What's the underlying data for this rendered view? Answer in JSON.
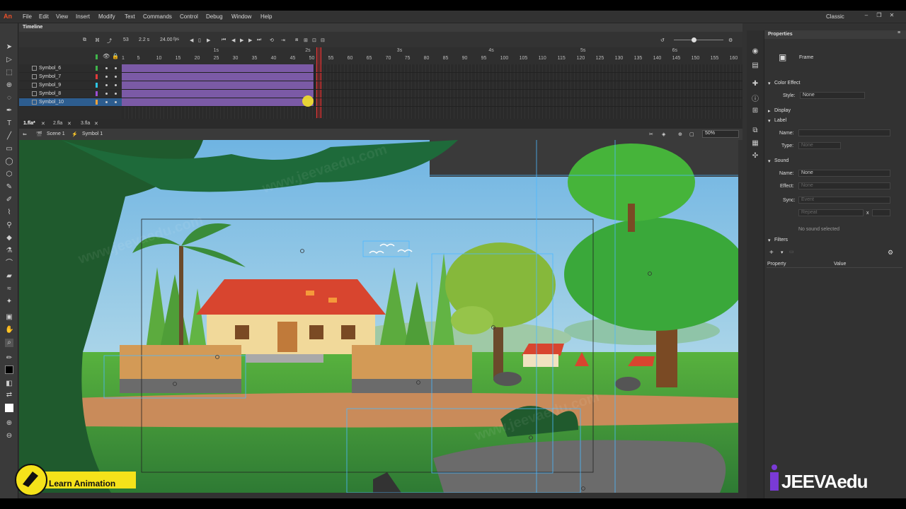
{
  "app": {
    "logo": "An",
    "menu": [
      "File",
      "Edit",
      "View",
      "Insert",
      "Modify",
      "Text",
      "Commands",
      "Control",
      "Debug",
      "Window",
      "Help"
    ],
    "workspace": "Classic"
  },
  "timeline": {
    "title": "Timeline",
    "current_frame": "53",
    "elapsed": "2.2 s",
    "fps": "24.00",
    "fps_unit": "fps",
    "seconds_marks": [
      "1s",
      "2s",
      "3s",
      "4s",
      "5s",
      "6s"
    ],
    "frame_numbers": [
      "1",
      "5",
      "10",
      "15",
      "20",
      "25",
      "30",
      "35",
      "40",
      "45",
      "50",
      "55",
      "60",
      "65",
      "70",
      "75",
      "80",
      "85",
      "90",
      "95",
      "100",
      "105",
      "110",
      "115",
      "120",
      "125",
      "130",
      "135",
      "140",
      "145",
      "150",
      "155",
      "160"
    ],
    "layers": [
      {
        "name": "Symbol_6",
        "color": "#3fb54b"
      },
      {
        "name": "Symbol_7",
        "color": "#e23b3b"
      },
      {
        "name": "Symbol_9",
        "color": "#2ec7e6"
      },
      {
        "name": "Symbol_8",
        "color": "#9c4fd6"
      },
      {
        "name": "Symbol_10",
        "color": "#f2a23a"
      }
    ],
    "tween_color": "#7b5aa6"
  },
  "doc_tabs": [
    "1.fla*",
    "2.fla",
    "3.fla"
  ],
  "edit_bar": {
    "scene": "Scene 1",
    "symbol": "Symbol 1",
    "zoom": "50%"
  },
  "properties": {
    "title": "Properties",
    "target": "Frame",
    "color_effect": {
      "section": "Color Effect",
      "style_label": "Style:",
      "style_value": "None"
    },
    "display": "Display",
    "label": {
      "section": "Label",
      "name_label": "Name:",
      "type_label": "Type:",
      "type_value": "None"
    },
    "sound": {
      "section": "Sound",
      "name_label": "Name:",
      "name_value": "None",
      "effect_label": "Effect:",
      "effect_value": "None",
      "sync_label": "Sync:",
      "sync_value": "Event",
      "repeat_value": "Repeat",
      "repeat_count": "x",
      "no_sound": "No sound selected"
    },
    "filters": {
      "section": "Filters",
      "col_property": "Property",
      "col_value": "Value"
    }
  },
  "overlay": {
    "badge_text": "Learn Animation",
    "brand_text": "JEEVAedu",
    "watermark": "www.jeevaedu.com"
  },
  "colors": {
    "sky": "#7fc3e6",
    "roof": "#d8452f",
    "wall": "#f1d99a",
    "grass": "#4aa63a",
    "path": "#c98b5a",
    "tree_dark": "#1f5a2d"
  }
}
